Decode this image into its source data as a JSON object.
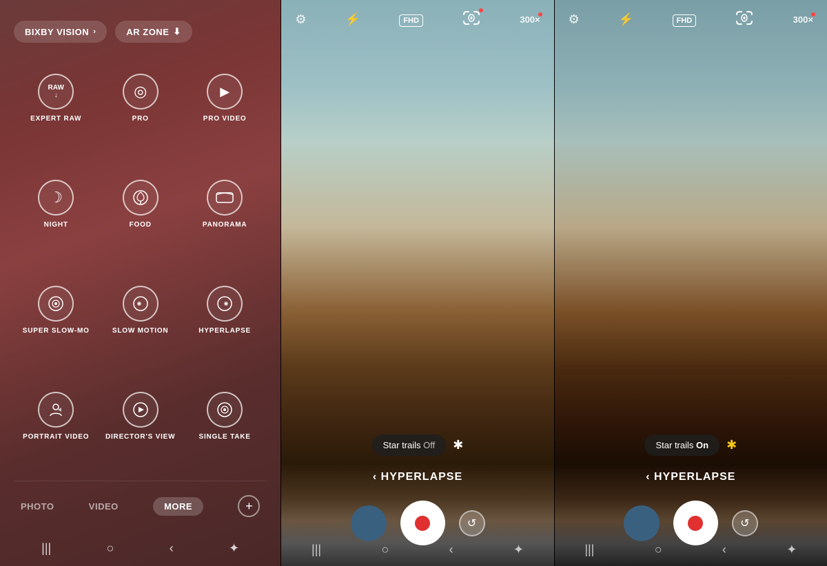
{
  "left_panel": {
    "top_buttons": [
      {
        "id": "bixby",
        "label": "BIXBY VISION",
        "has_chevron": true
      },
      {
        "id": "ar_zone",
        "label": "AR ZONE",
        "has_download": true
      }
    ],
    "modes": [
      {
        "id": "expert_raw",
        "icon": "raw",
        "label": "EXPERT RAW"
      },
      {
        "id": "pro",
        "icon": "pro",
        "label": "PRO"
      },
      {
        "id": "pro_video",
        "icon": "provid",
        "label": "PRO VIDEO"
      },
      {
        "id": "night",
        "icon": "night",
        "label": "NIGHT"
      },
      {
        "id": "food",
        "icon": "food",
        "label": "FOOD"
      },
      {
        "id": "panorama",
        "icon": "pano",
        "label": "PANORAMA"
      },
      {
        "id": "super_slow_mo",
        "icon": "superslow",
        "label": "SUPER SLOW-MO"
      },
      {
        "id": "slow_motion",
        "icon": "slowmo",
        "label": "SLOW MOTION"
      },
      {
        "id": "hyperlapse",
        "icon": "hyper",
        "label": "HYPERLAPSE"
      },
      {
        "id": "portrait_video",
        "icon": "portraitvid",
        "label": "PORTRAIT VIDEO"
      },
      {
        "id": "directors_view",
        "icon": "dirview",
        "label": "DIRECTOR'S VIEW"
      },
      {
        "id": "single_take",
        "icon": "singletake",
        "label": "SINGLE TAKE"
      }
    ],
    "nav_modes": [
      {
        "id": "photo",
        "label": "PHOTO",
        "active": false
      },
      {
        "id": "video",
        "label": "VIDEO",
        "active": false
      },
      "MORE"
    ],
    "nav_more_label": "MORE",
    "nav_plus_label": "+",
    "system_nav": [
      "|||",
      "○",
      "‹",
      "✦"
    ]
  },
  "middle_panel": {
    "header_icons": [
      "⚙",
      "⚡",
      "FHD",
      "∞",
      "300×"
    ],
    "fhd_label": "FHD",
    "timer_label": "300×",
    "star_trails_label": "Star trails",
    "star_trails_value": "Off",
    "hyperlapse_label": "‹ HYPERLAPSE",
    "system_nav": [
      "|||",
      "○",
      "‹",
      "✦"
    ]
  },
  "right_panel": {
    "header_icons": [
      "⚙",
      "⚡",
      "FHD",
      "∞",
      "300×"
    ],
    "fhd_label": "FHD",
    "timer_label": "300×",
    "star_trails_label": "Star trails",
    "star_trails_value": "On",
    "hyperlapse_label": "‹ HYPERLAPSE",
    "system_nav": [
      "|||",
      "○",
      "‹",
      "✦"
    ]
  },
  "colors": {
    "shutter_red": "#e03030",
    "gallery_blue": "#3a6080",
    "star_yellow": "#f5c518",
    "overlay_dark": "rgba(30,30,30,0.85)"
  }
}
